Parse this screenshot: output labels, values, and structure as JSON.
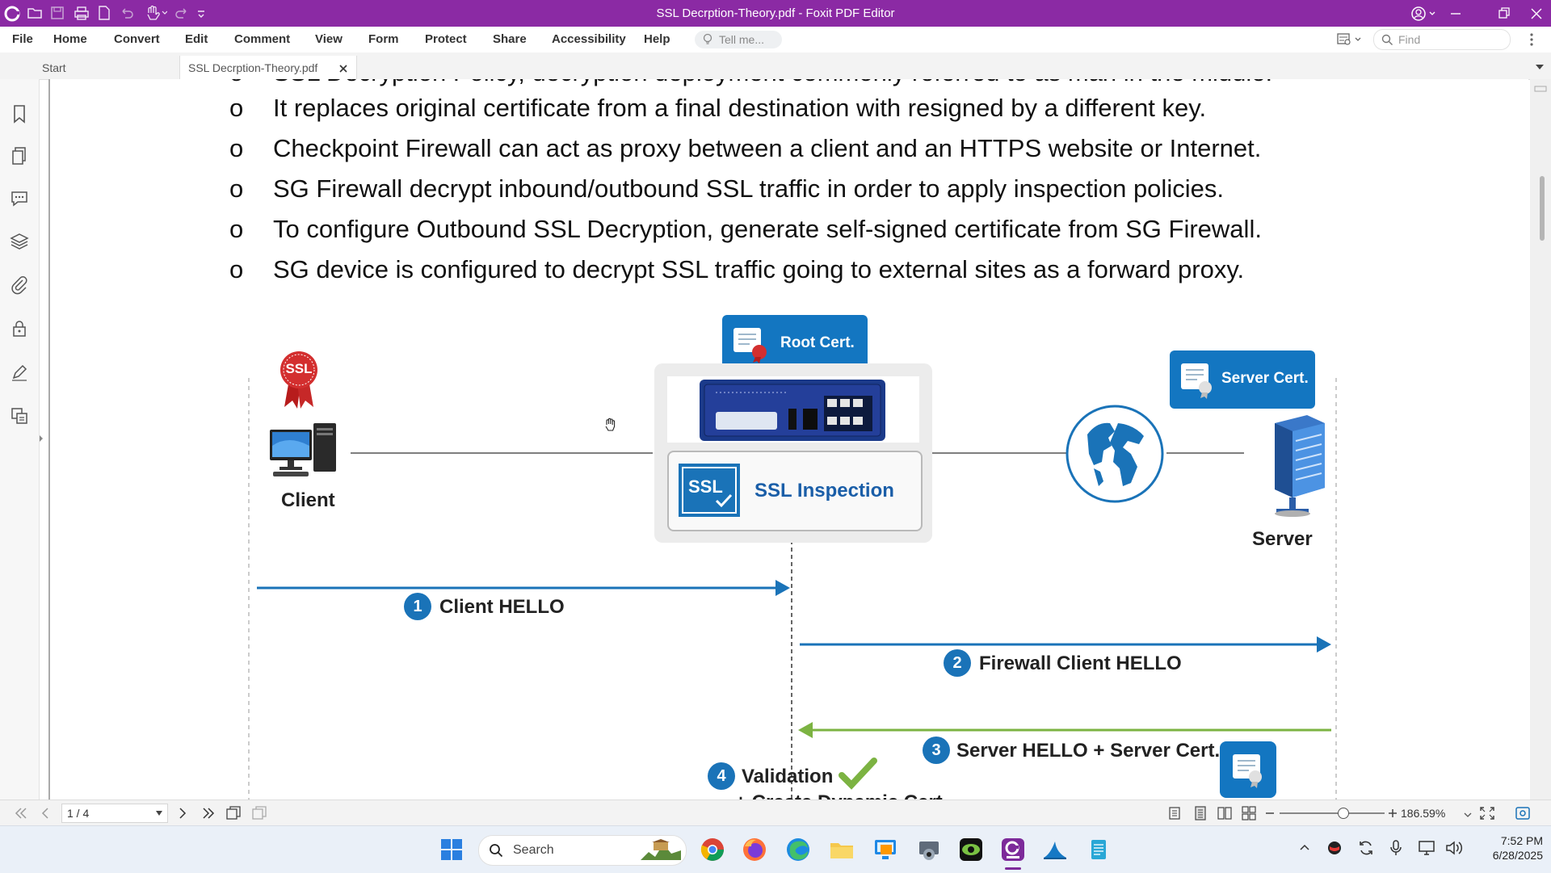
{
  "titlebar": {
    "title": "SSL Decrption-Theory.pdf - Foxit PDF Editor"
  },
  "menu": {
    "items": [
      "File",
      "Home",
      "Convert",
      "Edit",
      "Comment",
      "View",
      "Form",
      "Protect",
      "Share",
      "Accessibility",
      "Help"
    ],
    "tell_me_placeholder": "Tell me...",
    "find_placeholder": "Find"
  },
  "tabs": {
    "start": "Start",
    "document": "SSL Decrption-Theory.pdf"
  },
  "document": {
    "cut_top_line": "SSL Decryption Policy, decryption deployment commonly referred to as man in the middle.",
    "bullet_marker": "o",
    "bullets": [
      "It replaces original certificate from a final destination with resigned by a different key.",
      "Checkpoint Firewall can act as proxy between a client and an HTTPS website or Internet.",
      "SG Firewall decrypt inbound/outbound SSL traffic in order to apply inspection policies.",
      "To configure Outbound SSL Decryption, generate self-signed certificate from SG Firewall.",
      "SG device is configured to decrypt SSL traffic going to external sites as a forward proxy."
    ],
    "diagram": {
      "ssl_seal": "SSL",
      "client_label": "Client",
      "server_label": "Server",
      "root_cert": "Root Cert.",
      "server_cert": "Server Cert.",
      "ssl_inspection": "SSL Inspection",
      "ssl_box_text": "SSL",
      "steps": [
        {
          "num": "1",
          "text": "Client HELLO"
        },
        {
          "num": "2",
          "text": "Firewall Client HELLO"
        },
        {
          "num": "3",
          "text": "Server HELLO + Server Cert."
        },
        {
          "num": "4",
          "text": "Validation"
        }
      ],
      "cut_bottom_line": "+ Create Dynamic Cert."
    }
  },
  "statusbar": {
    "page": "1 / 4",
    "zoom": "186.59%"
  },
  "taskbar": {
    "search_placeholder": "Search",
    "time": "7:52 PM",
    "date": "6/28/2025"
  },
  "colors": {
    "titlebar": "#8b2aa4",
    "accent_blue": "#1a73b8",
    "arrow_green": "#7cb342",
    "ssl_red": "#d32f2f"
  }
}
